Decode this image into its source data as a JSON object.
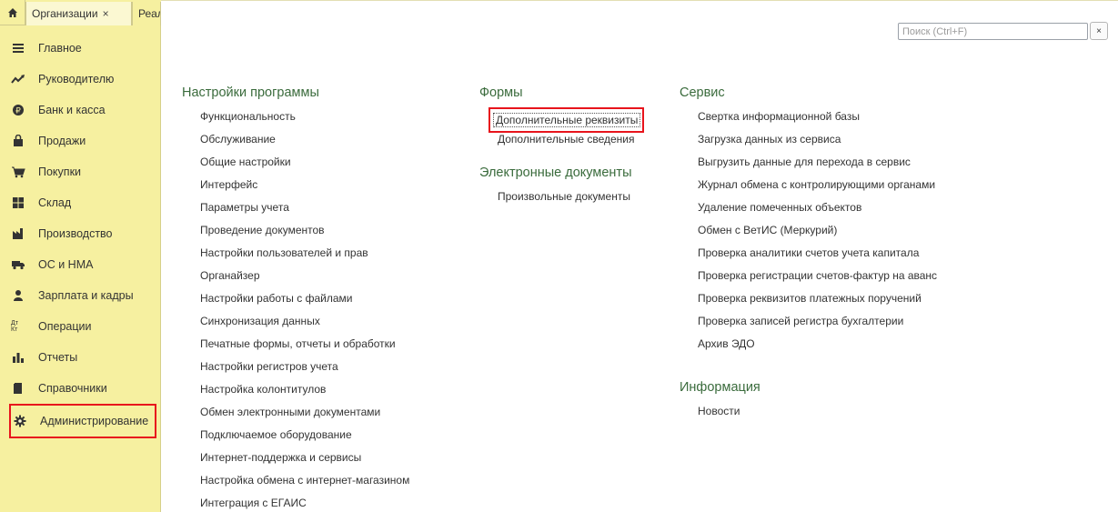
{
  "tabs": [
    {
      "label": "Организации",
      "close": "×"
    },
    {
      "label": "Реал"
    }
  ],
  "search": {
    "placeholder": "Поиск (Ctrl+F)",
    "clear": "×"
  },
  "sidebar": {
    "items": [
      {
        "label": "Главное",
        "icon": "menu-lines-icon"
      },
      {
        "label": "Руководителю",
        "icon": "trend-icon"
      },
      {
        "label": "Банк и касса",
        "icon": "ruble-coin-icon"
      },
      {
        "label": "Продажи",
        "icon": "shopping-bag-icon"
      },
      {
        "label": "Покупки",
        "icon": "cart-icon"
      },
      {
        "label": "Склад",
        "icon": "warehouse-icon"
      },
      {
        "label": "Производство",
        "icon": "factory-icon"
      },
      {
        "label": "ОС и НМА",
        "icon": "truck-icon"
      },
      {
        "label": "Зарплата и кадры",
        "icon": "person-icon"
      },
      {
        "label": "Операции",
        "icon": "debit-credit-icon",
        "icon_text": "Дт Кт"
      },
      {
        "label": "Отчеты",
        "icon": "bar-chart-icon"
      },
      {
        "label": "Справочники",
        "icon": "book-icon"
      },
      {
        "label": "Администрирование",
        "icon": "gear-icon"
      }
    ]
  },
  "columns": {
    "settings": {
      "title": "Настройки программы",
      "items": [
        "Функциональность",
        "Обслуживание",
        "Общие настройки",
        "Интерфейс",
        "Параметры учета",
        "Проведение документов",
        "Настройки пользователей и прав",
        "Органайзер",
        "Настройки работы с файлами",
        "Синхронизация данных",
        "Печатные формы, отчеты и обработки",
        "Настройки регистров учета",
        "Настройка колонтитулов",
        "Обмен электронными документами",
        "Подключаемое оборудование",
        "Интернет-поддержка и сервисы",
        "Настройка обмена с интернет-магазином",
        "Интеграция с ЕГАИС"
      ]
    },
    "forms": {
      "title": "Формы",
      "items": [
        "Дополнительные реквизиты",
        "Дополнительные сведения"
      ]
    },
    "edocs": {
      "title": "Электронные документы",
      "items": [
        "Произвольные документы"
      ]
    },
    "service": {
      "title": "Сервис",
      "items": [
        "Свертка информационной базы",
        "Загрузка данных из сервиса",
        "Выгрузить данные для перехода в сервис",
        "Журнал обмена с контролирующими органами",
        "Удаление помеченных объектов",
        "Обмен с ВетИС (Меркурий)",
        "Проверка аналитики счетов учета капитала",
        "Проверка регистрации счетов-фактур на аванс",
        "Проверка реквизитов платежных поручений",
        "Проверка записей регистра бухгалтерии",
        "Архив ЭДО"
      ]
    },
    "info": {
      "title": "Информация",
      "items": [
        "Новости"
      ]
    }
  },
  "colors": {
    "sidebar_bg": "#f6f0a0",
    "heading": "#3a6b3c",
    "highlight": "#e8141c"
  }
}
